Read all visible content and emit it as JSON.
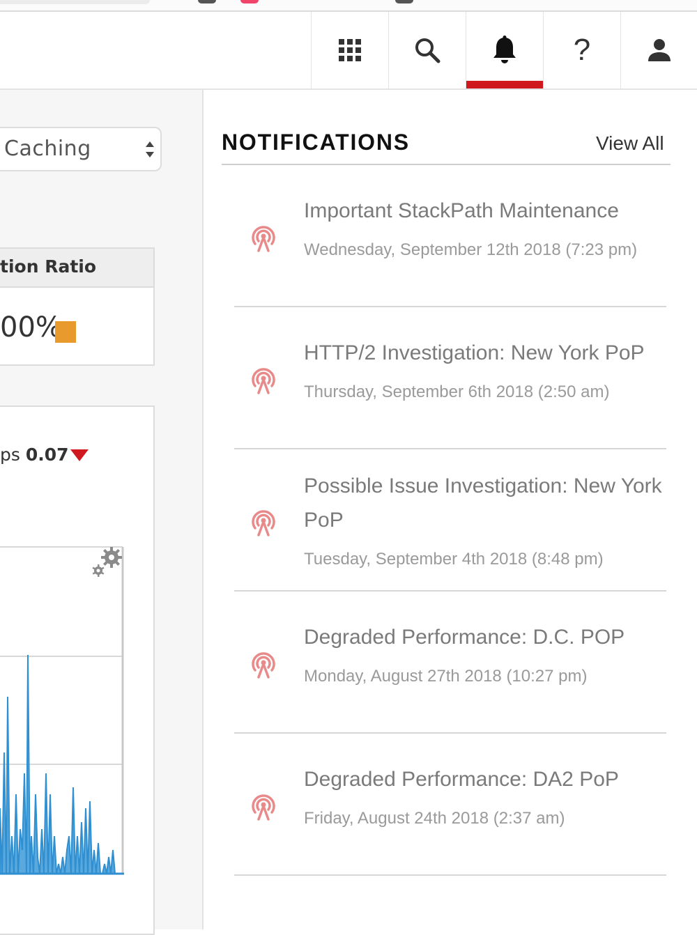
{
  "header": {
    "buttons": [
      {
        "name": "apps",
        "icon": "grid-icon"
      },
      {
        "name": "search",
        "icon": "search-icon"
      },
      {
        "name": "notifications",
        "icon": "bell-icon",
        "active": true
      },
      {
        "name": "help",
        "icon": "question-icon",
        "label": "?"
      },
      {
        "name": "account",
        "icon": "user-icon"
      }
    ],
    "active_color": "#d0191e"
  },
  "left": {
    "select_value": "Caching",
    "ratio_header": "tion Ratio",
    "ratio_value": "00%",
    "ratio_swatch_color": "#e89a2c",
    "metric_prefix": "ps",
    "metric_value": "0.07",
    "metric_trend_color": "#d0191e",
    "chart_color": "#2f8fd0"
  },
  "notifications": {
    "title": "NOTIFICATIONS",
    "view_all": "View All",
    "items": [
      {
        "title": "Important StackPath Maintenance",
        "date": "Wednesday, September 12th 2018 (7:23 pm)"
      },
      {
        "title": "HTTP/2 Investigation: New York PoP",
        "date": "Thursday, September 6th 2018 (2:50 am)"
      },
      {
        "title": "Possible Issue Investigation: New York PoP",
        "date": "Tuesday, September 4th 2018 (8:48 pm)"
      },
      {
        "title": "Degraded Performance: D.C. POP",
        "date": "Monday, August 27th 2018 (10:27 pm)"
      },
      {
        "title": "Degraded Performance: DA2 PoP",
        "date": "Friday, August 24th 2018 (2:37 am)"
      }
    ],
    "icon_color": "#e88a8a"
  }
}
